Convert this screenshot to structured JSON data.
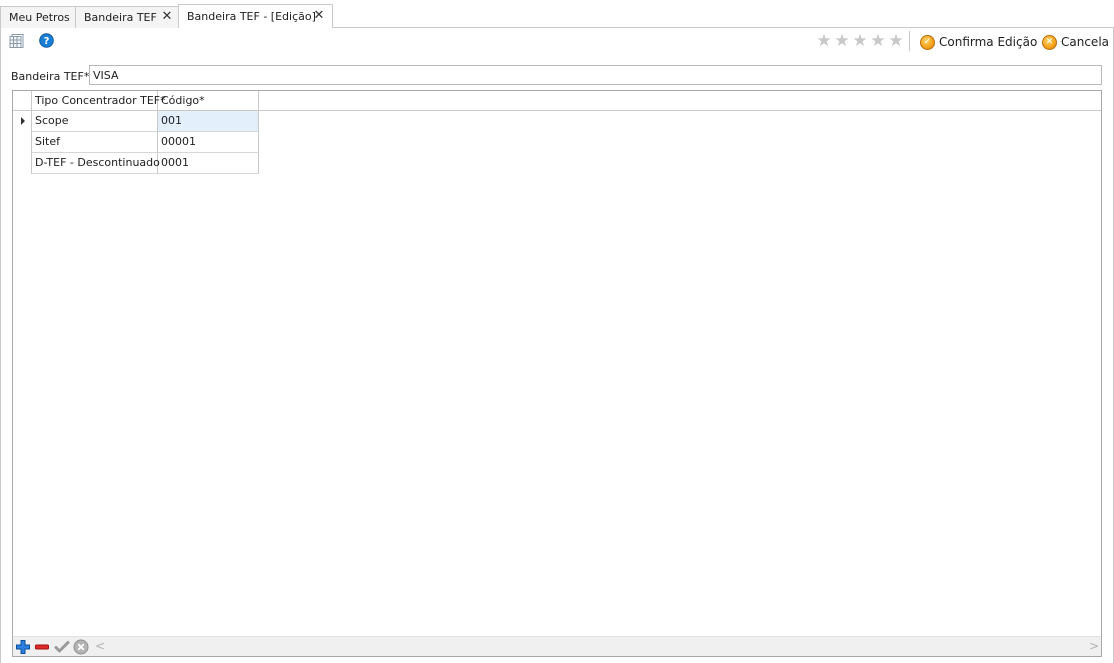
{
  "tabs": [
    {
      "label": "Meu Petros",
      "closable": false,
      "active": false
    },
    {
      "label": "Bandeira TEF",
      "closable": true,
      "active": false
    },
    {
      "label": "Bandeira TEF - [Edição]",
      "closable": true,
      "active": true
    }
  ],
  "close_glyph": "✕",
  "toolbar": {
    "rating_stars": 5,
    "star_glyph": "★",
    "confirm_label": "Confirma Edição",
    "cancel_label": "Cancela",
    "icons": [
      "grid-view-icon",
      "help-icon",
      "confirm-icon",
      "cancel-icon"
    ]
  },
  "form": {
    "label": "Bandeira TEF*:",
    "value": "VISA"
  },
  "grid": {
    "columns": [
      "Tipo Concentrador TEF*",
      "Código*"
    ],
    "rows": [
      [
        "Scope",
        "001"
      ],
      [
        "Sitef",
        "00001"
      ],
      [
        "D-TEF - Descontinuado",
        "0001"
      ]
    ],
    "current_row": 0
  },
  "navigator": {
    "icons": [
      "add-icon",
      "remove-icon",
      "confirm-check-icon",
      "cancel-circle-icon"
    ],
    "scroll_left_glyph": "<",
    "scroll_right_glyph": ">"
  },
  "colors": {
    "accent_orange": "#f4a21a",
    "add_blue": "#1f6fd6",
    "remove_red": "#d82020",
    "focused_cell": "#e3effa"
  }
}
